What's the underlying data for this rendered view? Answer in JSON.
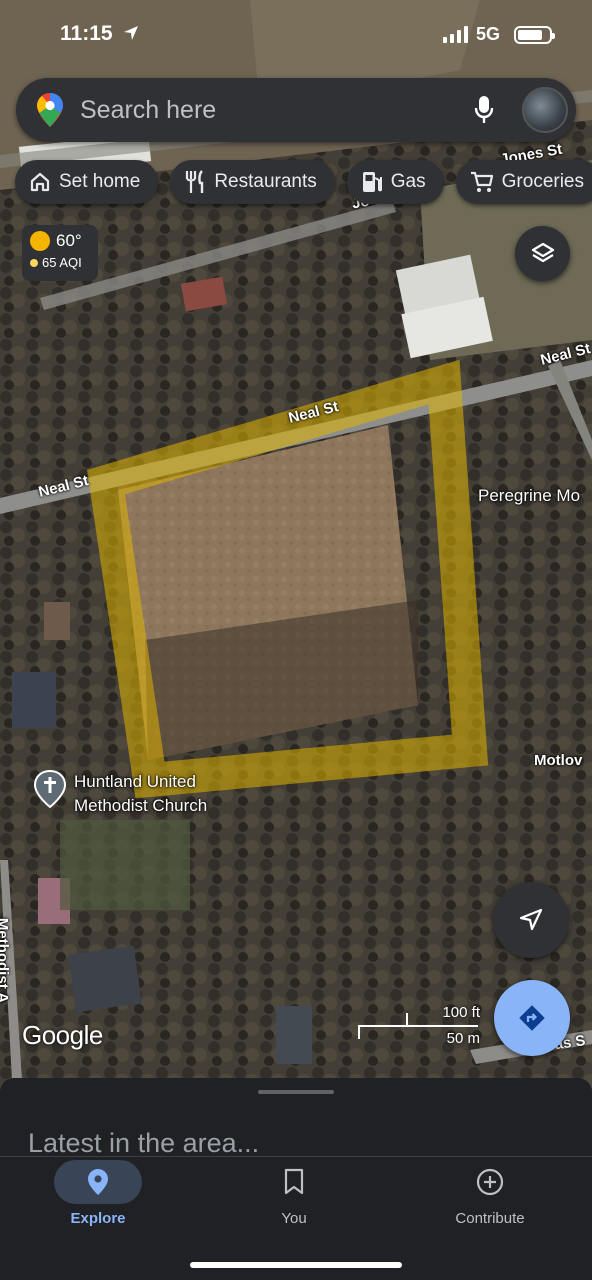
{
  "status_bar": {
    "time": "11:15",
    "network": "5G"
  },
  "search": {
    "placeholder": "Search here"
  },
  "chips": [
    {
      "label": "Set home",
      "icon": "home-icon"
    },
    {
      "label": "Restaurants",
      "icon": "fork-knife-icon"
    },
    {
      "label": "Gas",
      "icon": "gas-pump-icon"
    },
    {
      "label": "Groceries",
      "icon": "cart-icon"
    }
  ],
  "weather": {
    "temp": "60°",
    "aqi": "65 AQI"
  },
  "map": {
    "roads": [
      {
        "label": "Neal St"
      },
      {
        "label": "Neal St"
      },
      {
        "label": "Neal St"
      },
      {
        "label": "Jones St"
      },
      {
        "label": "Jo"
      },
      {
        "label": "Motlov"
      },
      {
        "label": "Methodist A"
      },
      {
        "label": "Lucas S"
      }
    ],
    "pois": [
      {
        "label": "Peregrine Mo"
      },
      {
        "label_line1": "Huntland United",
        "label_line2": "Methodist Church"
      }
    ],
    "highlight_color": "#e0b400",
    "scale": {
      "imperial": "100 ft",
      "metric": "50 m"
    },
    "logo": "Google"
  },
  "sheet": {
    "title": "Latest in the area..."
  },
  "bottom_nav": [
    {
      "label": "Explore",
      "active": true
    },
    {
      "label": "You",
      "active": false
    },
    {
      "label": "Contribute",
      "active": false
    }
  ],
  "colors": {
    "accent": "#8ab4f8",
    "surface": "#303134",
    "background": "#202124"
  }
}
